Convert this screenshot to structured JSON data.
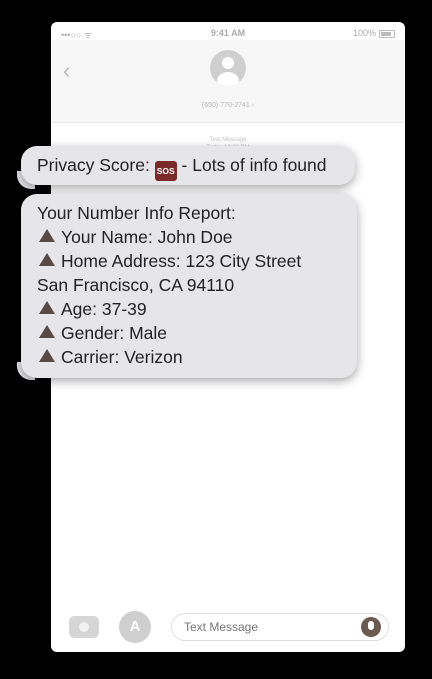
{
  "status_bar": {
    "carrier": "•••○○ ᯤ",
    "time": "9:41 AM",
    "battery": "100%"
  },
  "header": {
    "back": "‹",
    "contact": "(650) 770-2741 ›"
  },
  "thread_meta": {
    "label": "Text Message",
    "time": "Today 12:22 PM"
  },
  "bubble1": {
    "before": "Privacy Score: ",
    "badge": "SOS",
    "after": " - Lots of info found"
  },
  "bubble2": {
    "lines": [
      "Your Number Info Report:",
      "Your Name: John Doe",
      "Home Address: 123 City Street",
      "San Francisco, CA 94110",
      "Age: 37-39",
      "Gender: Male",
      "Carrier: Verizon"
    ]
  },
  "composer": {
    "placeholder": "Text Message",
    "appstore_glyph": "A"
  },
  "icons": [
    "back-chevron-icon",
    "contact-avatar-icon",
    "camera-icon",
    "app-store-icon",
    "microphone-icon",
    "warning-triangle-icon",
    "sos-badge-icon"
  ],
  "colors": {
    "bubble": "#e5e5ea",
    "sos_badge": "#7b2a2a",
    "triangle": "#5a4a44"
  }
}
